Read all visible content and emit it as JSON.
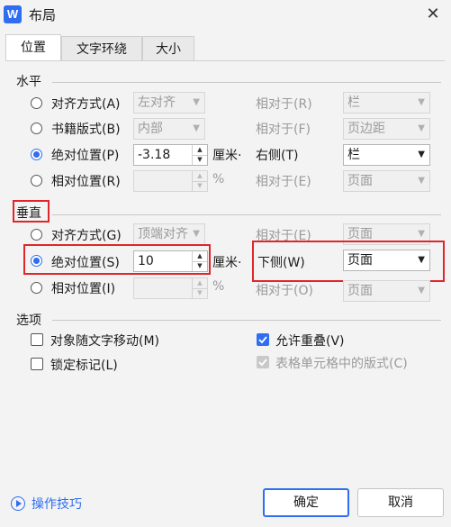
{
  "window": {
    "title": "布局",
    "app_icon_letter": "W",
    "close_glyph": "✕"
  },
  "tabs": [
    {
      "label": "位置"
    },
    {
      "label": "文字环绕"
    },
    {
      "label": "大小"
    }
  ],
  "horizontal": {
    "section_label": "水平",
    "rows": [
      {
        "label": "对齐方式(A)",
        "value": "左对齐",
        "rel_label": "相对于(R)",
        "rel_value": "栏"
      },
      {
        "label": "书籍版式(B)",
        "value": "内部",
        "rel_label": "相对于(F)",
        "rel_value": "页边距"
      },
      {
        "label": "绝对位置(P)",
        "value": "-3.18",
        "unit": "厘米·",
        "rel_label": "右侧(T)",
        "rel_value": "栏"
      },
      {
        "label": "相对位置(R)",
        "value": "",
        "unit": "%",
        "rel_label": "相对于(E)",
        "rel_value": "页面"
      }
    ]
  },
  "vertical": {
    "section_label": "垂直",
    "rows": [
      {
        "label": "对齐方式(G)",
        "value": "顶端对齐",
        "rel_label": "相对于(E)",
        "rel_value": "页面"
      },
      {
        "label": "绝对位置(S)",
        "value": "10",
        "unit": "厘米·",
        "rel_label": "下侧(W)",
        "rel_value": "页面"
      },
      {
        "label": "相对位置(I)",
        "value": "",
        "unit": "%",
        "rel_label": "相对于(O)",
        "rel_value": "页面"
      }
    ]
  },
  "options": {
    "section_label": "选项",
    "move_with_text": "对象随文字移动(M)",
    "lock_anchor": "锁定标记(L)",
    "allow_overlap": "允许重叠(V)",
    "table_cell_layout": "表格单元格中的版式(C)"
  },
  "footer": {
    "help": "操作技巧",
    "ok": "确定",
    "cancel": "取消"
  },
  "colors": {
    "accent": "#2f6ef0",
    "highlight": "#e0262b"
  }
}
